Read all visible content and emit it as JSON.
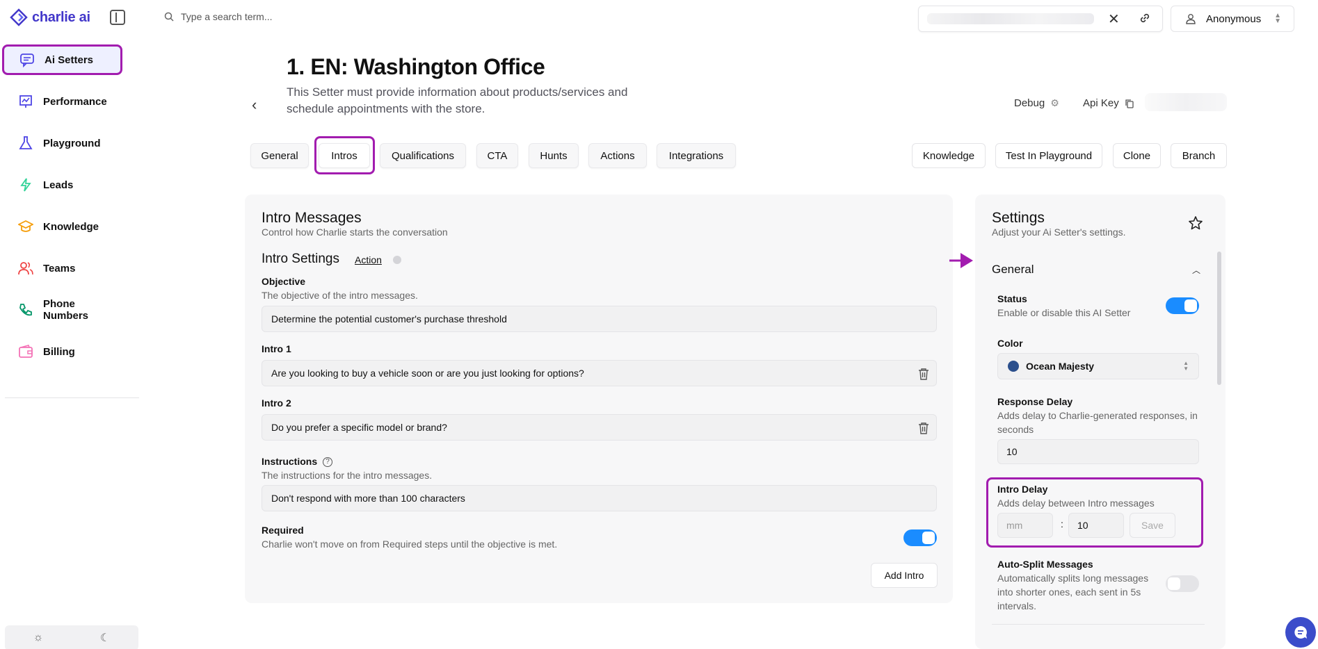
{
  "app": {
    "brand": "charlie ai"
  },
  "sidebar": {
    "items": [
      {
        "label": "Ai Setters",
        "icon": "chat-bubble-icon"
      },
      {
        "label": "Performance",
        "icon": "chart-icon"
      },
      {
        "label": "Playground",
        "icon": "flask-icon"
      },
      {
        "label": "Leads",
        "icon": "lightning-icon"
      },
      {
        "label": "Knowledge",
        "icon": "graduation-cap-icon"
      },
      {
        "label": "Teams",
        "icon": "users-icon"
      },
      {
        "label": "Phone Numbers",
        "icon": "phone-icon"
      },
      {
        "label": "Billing",
        "icon": "wallet-icon"
      }
    ]
  },
  "search": {
    "placeholder": "Type a search term..."
  },
  "user": {
    "name": "Anonymous"
  },
  "header": {
    "title": "1. EN: Washington Office",
    "subtitle": "This Setter must provide information about products/services and schedule appointments with the store.",
    "debug_label": "Debug",
    "apikey_label": "Api Key"
  },
  "tabs": [
    "General",
    "Intros",
    "Qualifications",
    "CTA",
    "Hunts",
    "Actions",
    "Integrations"
  ],
  "active_tab": "Intros",
  "actions": [
    "Knowledge",
    "Test In Playground",
    "Clone",
    "Branch"
  ],
  "intro": {
    "title": "Intro Messages",
    "subtitle": "Control how Charlie starts the conversation",
    "settings_title": "Intro Settings",
    "action_link": "Action",
    "objective_label": "Objective",
    "objective_desc": "The objective of the intro messages.",
    "objective_value": "Determine the potential customer's purchase threshold",
    "intro1_label": "Intro 1",
    "intro1_value": "Are you looking to buy a vehicle soon or are you just looking for options?",
    "intro2_label": "Intro 2",
    "intro2_value": "Do you prefer a specific model or brand?",
    "instructions_label": "Instructions",
    "instructions_desc": "The instructions for the intro messages.",
    "instructions_value": "Don't respond with more than 100 characters",
    "required_label": "Required",
    "required_desc": "Charlie won't move on from Required steps until the objective is met.",
    "required_on": true,
    "add_intro": "Add Intro"
  },
  "settings": {
    "title": "Settings",
    "subtitle": "Adjust your Ai Setter's settings.",
    "group": "General",
    "status_label": "Status",
    "status_desc": "Enable or disable this AI Setter",
    "status_on": true,
    "color_label": "Color",
    "color_value": "Ocean Majesty",
    "color_hex": "#2b4f8c",
    "response_delay_label": "Response Delay",
    "response_delay_desc": "Adds delay to Charlie-generated responses, in seconds",
    "response_delay_value": "10",
    "intro_delay_label": "Intro Delay",
    "intro_delay_desc": "Adds delay between Intro messages",
    "intro_delay_mm_placeholder": "mm",
    "intro_delay_sep": ":",
    "intro_delay_ss": "10",
    "save_label": "Save",
    "autosplit_label": "Auto-Split Messages",
    "autosplit_desc": "Automatically splits long messages into shorter ones, each sent in 5s intervals.",
    "autosplit_on": false
  },
  "colors": {
    "accent": "#a21caf",
    "brand": "#4338ca",
    "toggle_on": "#1a8cff"
  }
}
